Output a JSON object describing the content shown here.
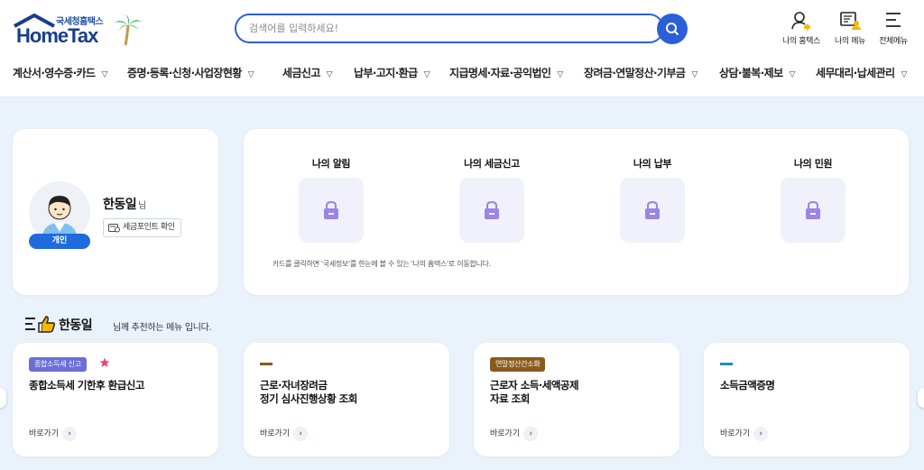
{
  "logo": {
    "sub": "국세청홈택스",
    "main": "HomeTax"
  },
  "search": {
    "placeholder": "검색어를 입력하세요!"
  },
  "utils": [
    {
      "label": "나의 홈택스",
      "icon": "user-bell-icon"
    },
    {
      "label": "나의 메뉴",
      "icon": "my-menu-icon"
    },
    {
      "label": "전체메뉴",
      "icon": "hamburger-icon"
    }
  ],
  "gnb": [
    "계산서·영수증·카드",
    "증명·등록·신청·사업장현황",
    "세금신고",
    "납부·고지·환급",
    "지급명세·자료·공익법인",
    "장려금·연말정산·기부금",
    "상담·불복·제보",
    "세무대리·납세관리"
  ],
  "profile": {
    "name": "한동일",
    "suffix": "님",
    "badge": "개인",
    "point_button": "세금포인트 확인"
  },
  "my": {
    "columns": [
      "나의 알림",
      "나의 세금신고",
      "나의 납부",
      "나의 민원"
    ],
    "note": "카드를 클릭하면 '국세정보'를 한눈에 볼 수 있는 '나의 홈택스'로 이동합니다."
  },
  "recommend": {
    "name": "한동일",
    "rest": "님께 추천하는 메뉴 입니다.",
    "cards": [
      {
        "tag": "종합소득세 신고",
        "title": "종합소득세 기한후 환급신고",
        "go": "바로가기"
      },
      {
        "tag": "",
        "title": "근로·자녀장려금\n정기 심사진행상황 조회",
        "go": "바로가기"
      },
      {
        "tag": "연말정산간소화",
        "title": "근로자 소득·세액공제\n자료 조회",
        "go": "바로가기"
      },
      {
        "tag": "",
        "title": "소득금액증명",
        "go": "바로가기"
      }
    ]
  },
  "colors": {
    "primary": "#2a5fd8",
    "tag_purple": "#6b6fd6",
    "tag_brown": "#8a5a1c",
    "bar_brown": "#8a5a1c",
    "bar_teal": "#1a8fb5",
    "star": "#e8487a"
  }
}
